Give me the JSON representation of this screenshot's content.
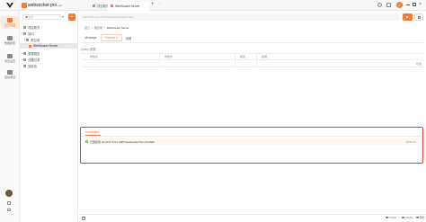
{
  "app": {
    "project_name": "websocket pro...",
    "window_tabs": [
      "项目概况",
      "WebSocket Server"
    ],
    "add_tab": "+",
    "search_placeholder": "搜索",
    "url_value": "ws://127.0.0.1:3007/websocket?form=test",
    "user_initial": "Z",
    "accent": "#f47a36"
  },
  "rail": {
    "items": [
      {
        "label": "接口管理",
        "icon": "api-icon",
        "active": true
      },
      {
        "label": "数据模型",
        "icon": "model-icon",
        "active": false
      },
      {
        "label": "项目设置",
        "icon": "settings-icon",
        "active": false
      },
      {
        "label": "自动测试",
        "icon": "test-icon",
        "active": false
      }
    ]
  },
  "tree": {
    "rows": [
      {
        "label": "项目概况"
      },
      {
        "label": "接口"
      },
      {
        "label": "根目录"
      },
      {
        "label": "WebSocket Server"
      },
      {
        "label": "数据模型"
      },
      {
        "label": "快捷请求"
      },
      {
        "label": "回收站"
      }
    ]
  },
  "main": {
    "breadcrumb": [
      "接口",
      "根目录",
      "WebSocket Server"
    ],
    "tabs": [
      "Message",
      "Params",
      "设置"
    ],
    "params_count": "0",
    "section_label": "Query 参数",
    "columns": [
      "参数名",
      "参数值",
      "类型",
      "说明"
    ],
    "batch_edit": "批量",
    "messages_tab": "Messages",
    "message_text": "已连接到 ws://127.0.0.1:3007/websocket?form=hahah",
    "message_time": "14:52:42",
    "footer": {
      "online": "Online",
      "cookie": "Cookie",
      "help": "帮助"
    }
  }
}
